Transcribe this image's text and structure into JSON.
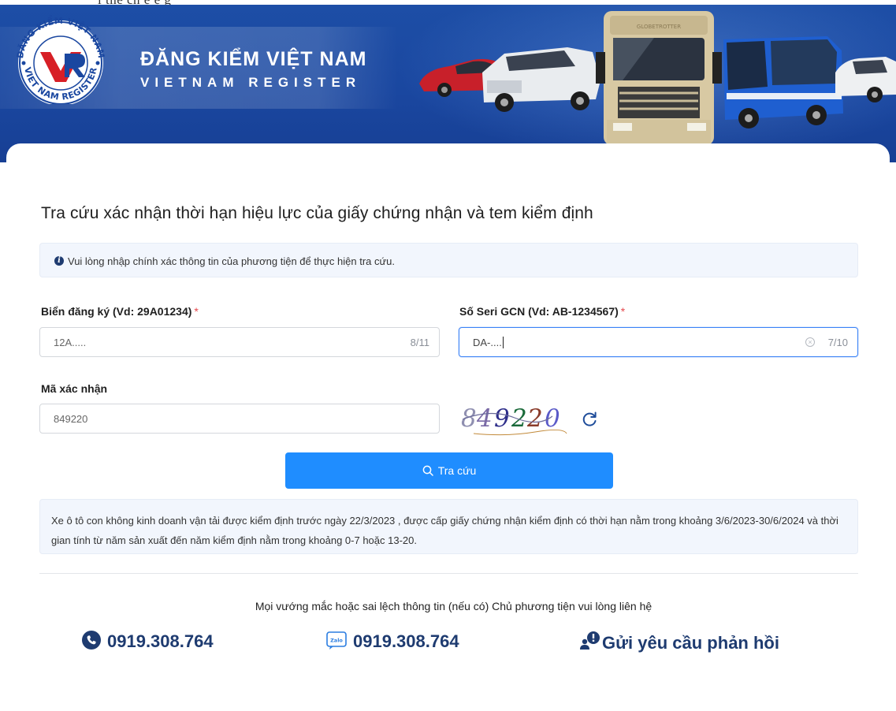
{
  "header": {
    "top_strip_text": "i thể ch ệ ệ g",
    "logo_text_top": "ĐĂNG KIỂM VIỆT NAM",
    "logo_text_bottom": "VIET NAM REGISTER",
    "brand_title": "ĐĂNG KIỂM VIỆT NAM",
    "brand_subtitle": "VIETNAM REGISTER",
    "truck_sign": "GLOBETROTTER",
    "colors": {
      "banner": "#1a47a0",
      "brand_red": "#d71f26"
    }
  },
  "page": {
    "title": "Tra cứu xác nhận thời hạn hiệu lực của giấy chứng nhận và tem kiểm định",
    "info_icon": "info-circle-icon",
    "info_text": "Vui lòng nhập chính xác thông tin của phương tiện để thực hiện tra cứu."
  },
  "form": {
    "plate": {
      "label": "Biển đăng ký (Vd: 29A01234)",
      "required": "*",
      "value": "12A.....",
      "count": "8/11"
    },
    "serial": {
      "label": "Số Seri GCN (Vd: AB-1234567)",
      "required": "*",
      "value": "DA-....",
      "count": "7/10"
    },
    "captcha": {
      "label": "Mã xác nhận",
      "value": "849220",
      "image_text": "849220",
      "refresh_icon": "refresh-icon"
    },
    "search_button": "Tra cứu"
  },
  "note": {
    "text": "Xe ô tô con không kinh doanh vận tải được kiểm định trước ngày 22/3/2023 , được cấp giấy chứng nhận kiểm định có thời hạn nằm trong khoảng 3/6/2023-30/6/2024 và thời gian tính từ năm sản xuất đến năm kiểm định nằm trong khoảng 0-7 hoặc 13-20."
  },
  "contact": {
    "text": "Mọi vướng mắc hoặc sai lệch thông tin (nếu có) Chủ phương tiện vui lòng liên hệ",
    "phone": "0919.308.764",
    "zalo": "0919.308.764",
    "zalo_icon_text": "Zalo",
    "feedback": "Gửi yêu cầu phản hồi",
    "color": "#1e3b70"
  }
}
